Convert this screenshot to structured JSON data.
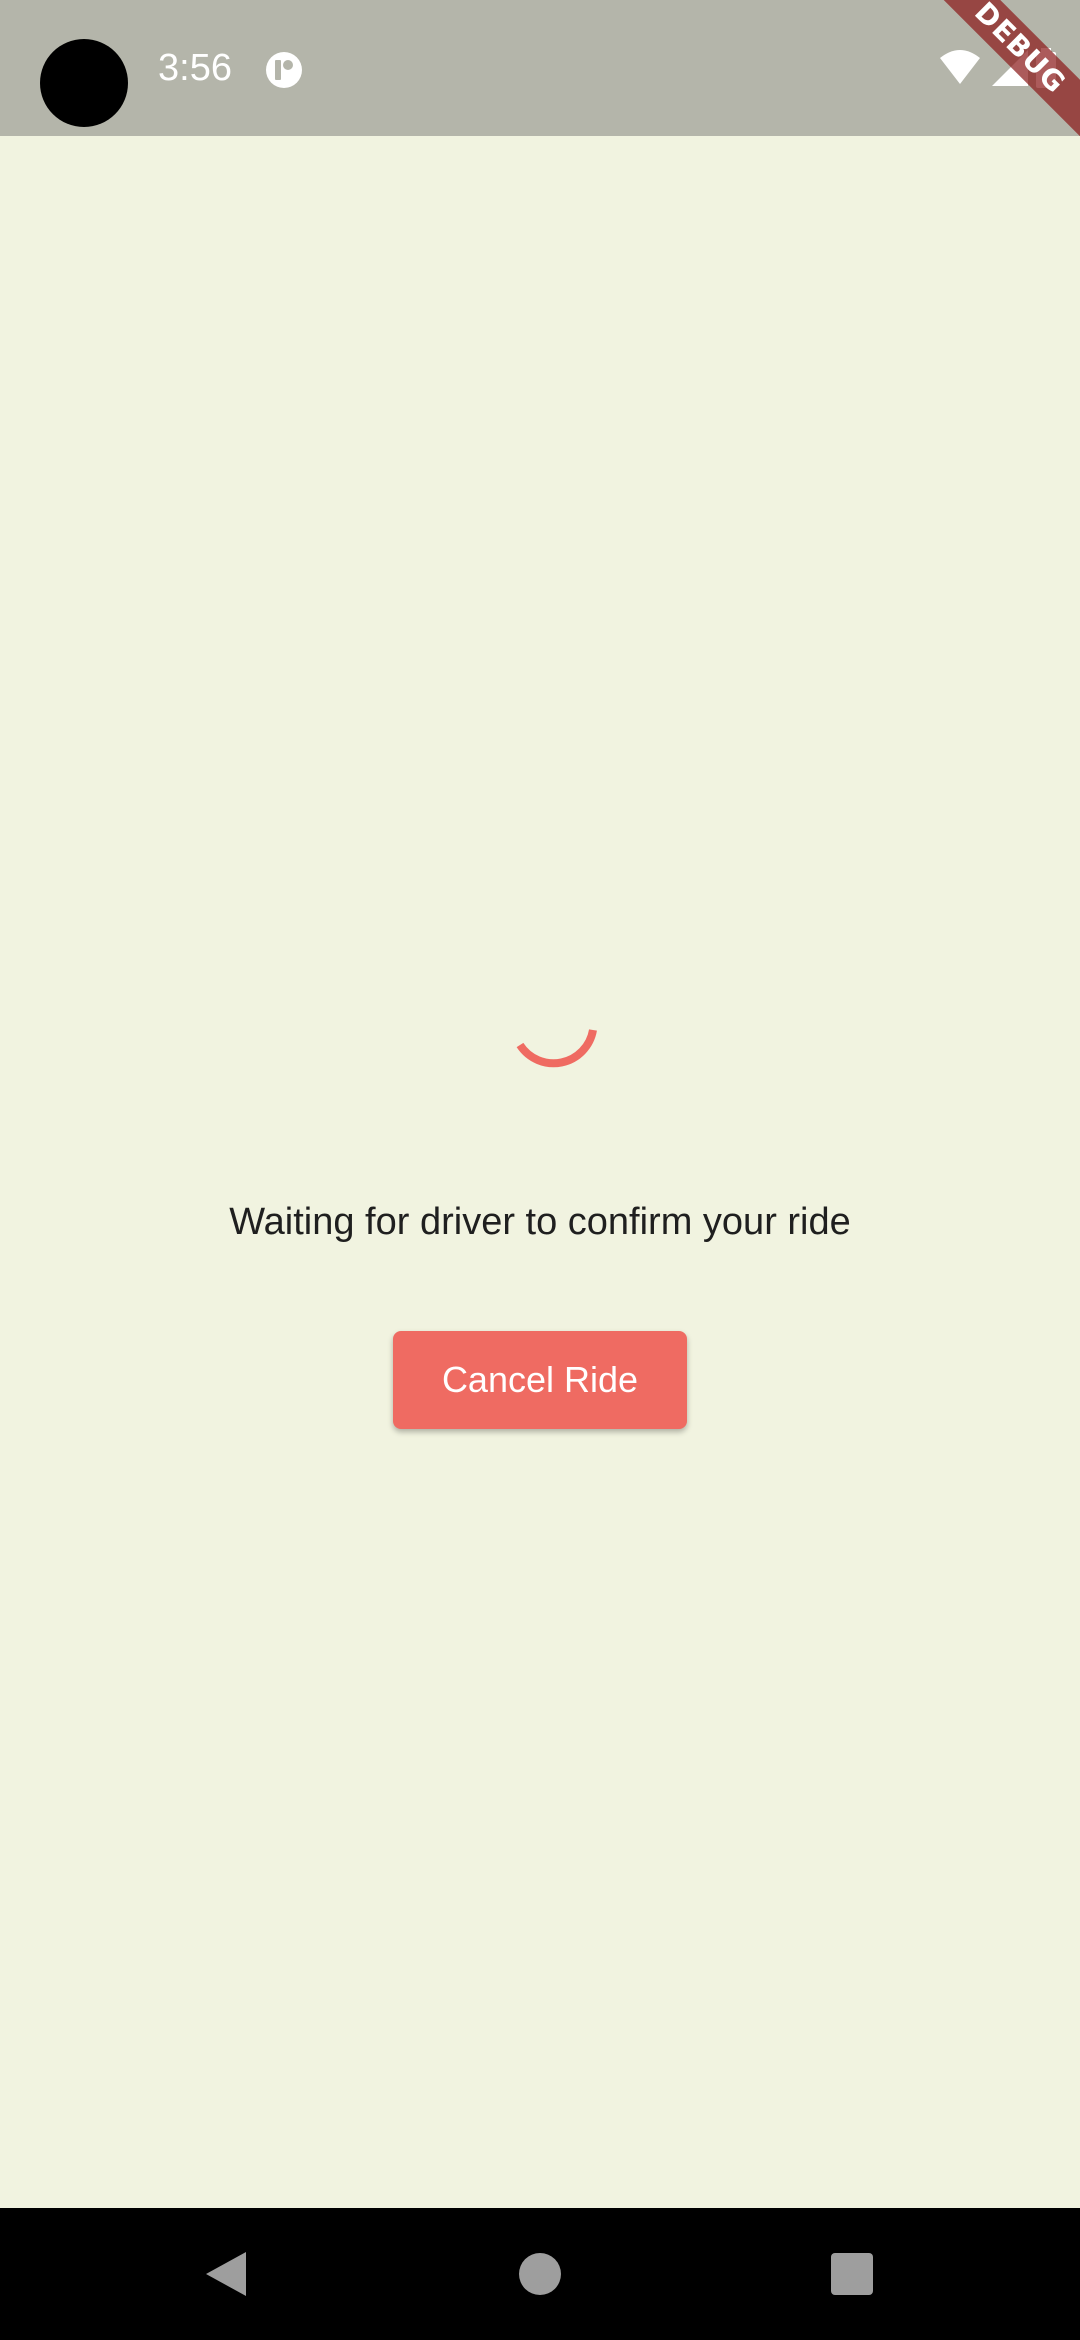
{
  "status_bar": {
    "time": "3:56",
    "icons": [
      "camera-cutout",
      "app-notification-icon",
      "wifi-icon",
      "cellular-signal-icon",
      "battery-icon"
    ],
    "debug_banner": "DEBUG",
    "background_color": "#b4b5aa"
  },
  "main": {
    "background_color": "#f1f3e0",
    "loading_indicator": "spinner-icon",
    "accent_color": "#ef6b62",
    "message": "Waiting for driver to confirm your ride",
    "cancel_button_label": "Cancel Ride"
  },
  "nav_bar": {
    "buttons": [
      "back-icon",
      "home-icon",
      "recents-icon"
    ]
  }
}
